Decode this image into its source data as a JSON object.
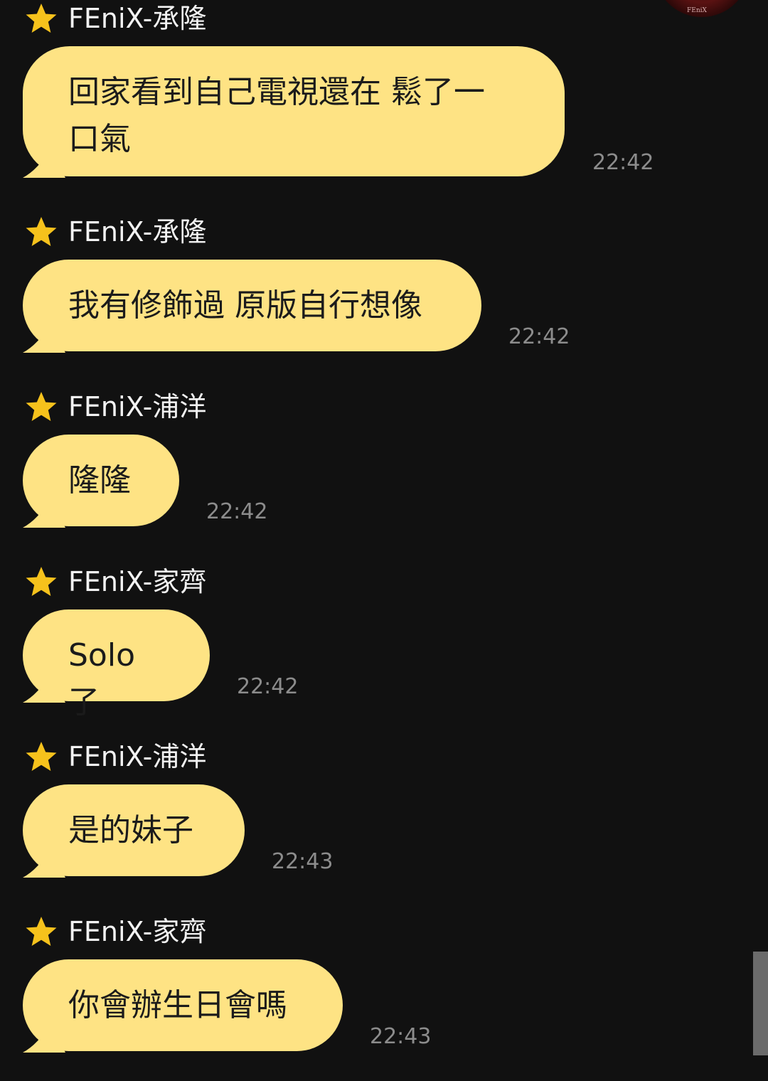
{
  "messages": [
    {
      "sender": "FEniX-承隆",
      "text": "回家看到自己電視還在 鬆了一\n口氣",
      "time": "22:42"
    },
    {
      "sender": "FEniX-承隆",
      "text": "我有修飾過 原版自行想像",
      "time": "22:42"
    },
    {
      "sender": "FEniX-浦洋",
      "text": "隆隆",
      "time": "22:42"
    },
    {
      "sender": "FEniX-家齊",
      "text": "Solo了",
      "time": "22:42"
    },
    {
      "sender": "FEniX-浦洋",
      "text": "是的妹子",
      "time": "22:43"
    },
    {
      "sender": "FEniX-家齊",
      "text": "你會辦生日會嗎",
      "time": "22:43"
    }
  ],
  "avatar": {
    "mark": "FEniX"
  },
  "colors": {
    "background": "#111111",
    "bubble": "#fee384",
    "star": "#f6c21c",
    "timestamp": "#8c8c8c",
    "sender_text": "#f2f2f2",
    "scrollbar_thumb": "#6b6b6b"
  },
  "icons": {
    "sender_badge": "star-icon"
  }
}
